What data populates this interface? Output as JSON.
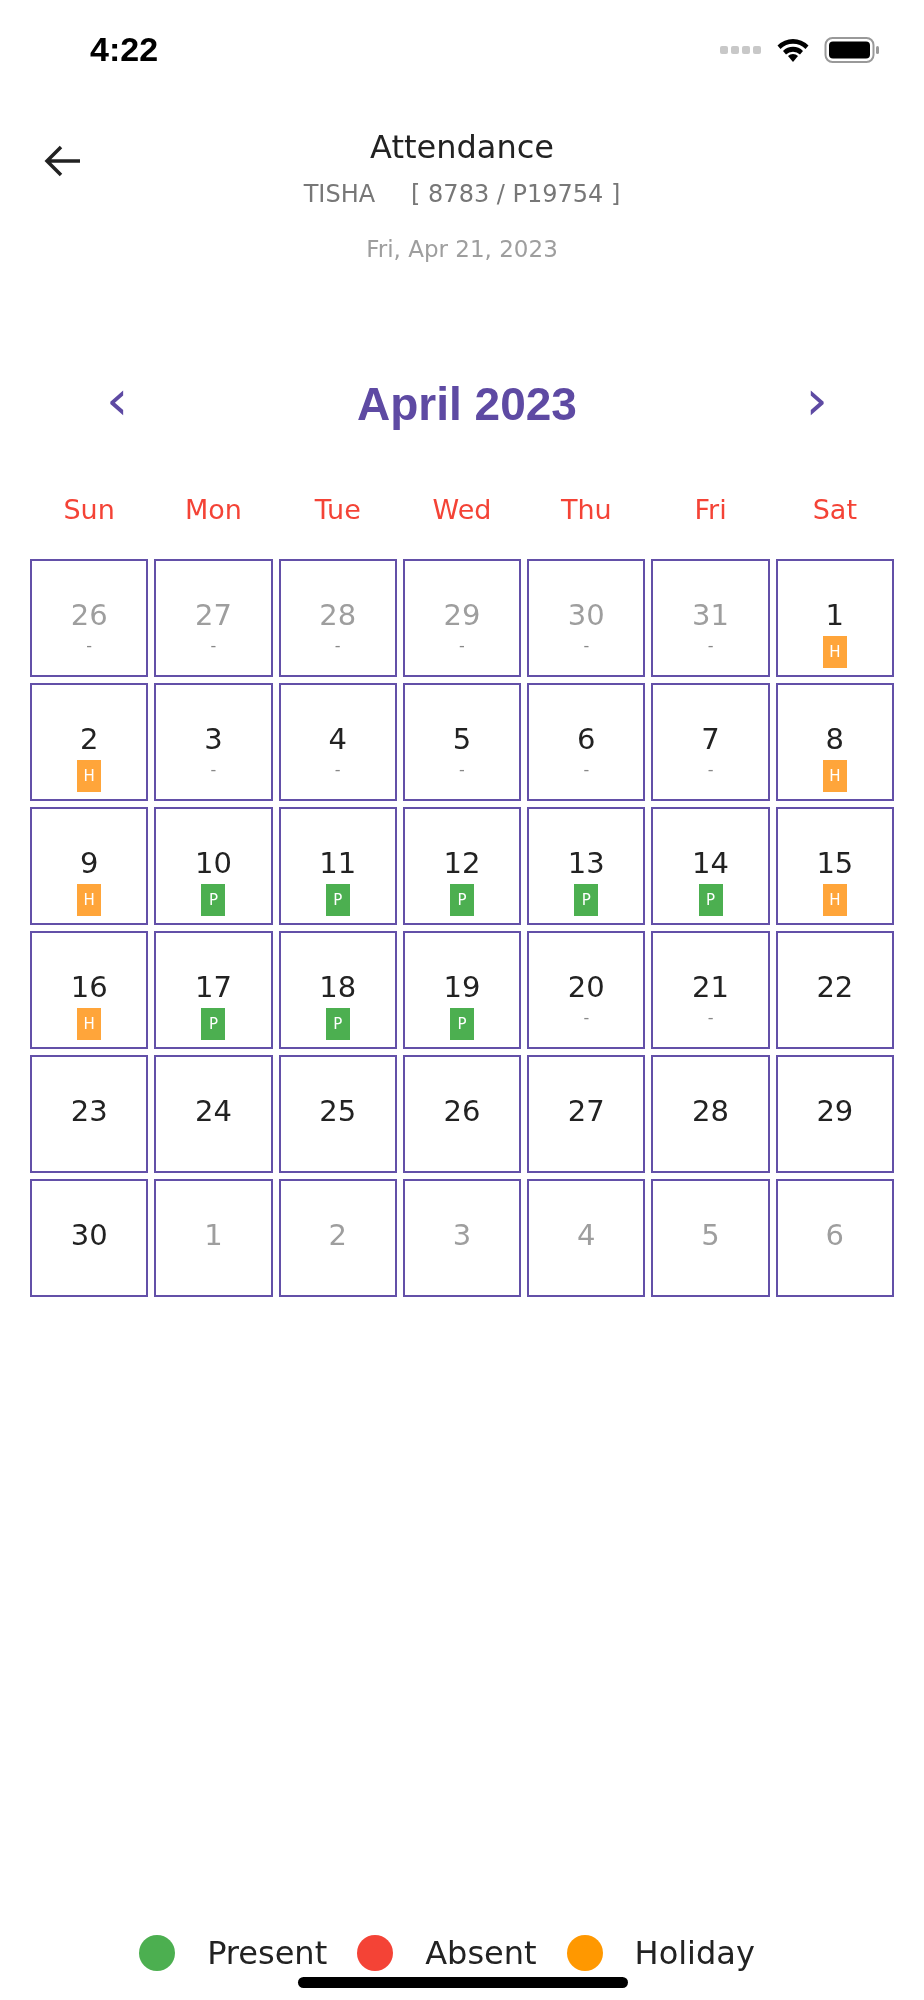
{
  "status_bar": {
    "time": "4:22"
  },
  "header": {
    "title": "Attendance",
    "name": "TISHA",
    "ids": "[ 8783 / P19754 ]",
    "date": "Fri, Apr 21, 2023"
  },
  "calendar": {
    "month": "April 2023",
    "prev": "‹",
    "next": "›",
    "weekdays": [
      "Sun",
      "Mon",
      "Tue",
      "Wed",
      "Thu",
      "Fri",
      "Sat"
    ],
    "days": [
      {
        "day": "26",
        "outside": true,
        "kind": "dash",
        "mark": "-"
      },
      {
        "day": "27",
        "outside": true,
        "kind": "dash",
        "mark": "-"
      },
      {
        "day": "28",
        "outside": true,
        "kind": "dash",
        "mark": "-"
      },
      {
        "day": "29",
        "outside": true,
        "kind": "dash",
        "mark": "-"
      },
      {
        "day": "30",
        "outside": true,
        "kind": "dash",
        "mark": "-"
      },
      {
        "day": "31",
        "outside": true,
        "kind": "dash",
        "mark": "-"
      },
      {
        "day": "1",
        "outside": false,
        "kind": "holiday",
        "mark": "H"
      },
      {
        "day": "2",
        "outside": false,
        "kind": "holiday",
        "mark": "H"
      },
      {
        "day": "3",
        "outside": false,
        "kind": "dash",
        "mark": "-"
      },
      {
        "day": "4",
        "outside": false,
        "kind": "dash",
        "mark": "-"
      },
      {
        "day": "5",
        "outside": false,
        "kind": "dash",
        "mark": "-"
      },
      {
        "day": "6",
        "outside": false,
        "kind": "dash",
        "mark": "-"
      },
      {
        "day": "7",
        "outside": false,
        "kind": "dash",
        "mark": "-"
      },
      {
        "day": "8",
        "outside": false,
        "kind": "holiday",
        "mark": "H"
      },
      {
        "day": "9",
        "outside": false,
        "kind": "holiday",
        "mark": "H"
      },
      {
        "day": "10",
        "outside": false,
        "kind": "present",
        "mark": "P"
      },
      {
        "day": "11",
        "outside": false,
        "kind": "present",
        "mark": "P"
      },
      {
        "day": "12",
        "outside": false,
        "kind": "present",
        "mark": "P"
      },
      {
        "day": "13",
        "outside": false,
        "kind": "present",
        "mark": "P"
      },
      {
        "day": "14",
        "outside": false,
        "kind": "present",
        "mark": "P"
      },
      {
        "day": "15",
        "outside": false,
        "kind": "holiday",
        "mark": "H"
      },
      {
        "day": "16",
        "outside": false,
        "kind": "holiday",
        "mark": "H"
      },
      {
        "day": "17",
        "outside": false,
        "kind": "present",
        "mark": "P"
      },
      {
        "day": "18",
        "outside": false,
        "kind": "present",
        "mark": "P"
      },
      {
        "day": "19",
        "outside": false,
        "kind": "present",
        "mark": "P"
      },
      {
        "day": "20",
        "outside": false,
        "kind": "dash",
        "mark": "-"
      },
      {
        "day": "21",
        "outside": false,
        "kind": "dash",
        "mark": "-"
      },
      {
        "day": "22",
        "outside": false,
        "kind": "blank"
      },
      {
        "day": "23",
        "outside": false,
        "kind": "blank"
      },
      {
        "day": "24",
        "outside": false,
        "kind": "blank"
      },
      {
        "day": "25",
        "outside": false,
        "kind": "blank"
      },
      {
        "day": "26",
        "outside": false,
        "kind": "blank"
      },
      {
        "day": "27",
        "outside": false,
        "kind": "blank"
      },
      {
        "day": "28",
        "outside": false,
        "kind": "blank"
      },
      {
        "day": "29",
        "outside": false,
        "kind": "blank"
      },
      {
        "day": "30",
        "outside": false,
        "kind": "blank"
      },
      {
        "day": "1",
        "outside": true,
        "kind": "blank"
      },
      {
        "day": "2",
        "outside": true,
        "kind": "blank"
      },
      {
        "day": "3",
        "outside": true,
        "kind": "blank"
      },
      {
        "day": "4",
        "outside": true,
        "kind": "blank"
      },
      {
        "day": "5",
        "outside": true,
        "kind": "blank"
      },
      {
        "day": "6",
        "outside": true,
        "kind": "blank"
      }
    ]
  },
  "legend": [
    {
      "label": "Present",
      "color": "#4caf50"
    },
    {
      "label": "Absent",
      "color": "#f44336"
    },
    {
      "label": "Holiday",
      "color": "#ff9800"
    }
  ]
}
